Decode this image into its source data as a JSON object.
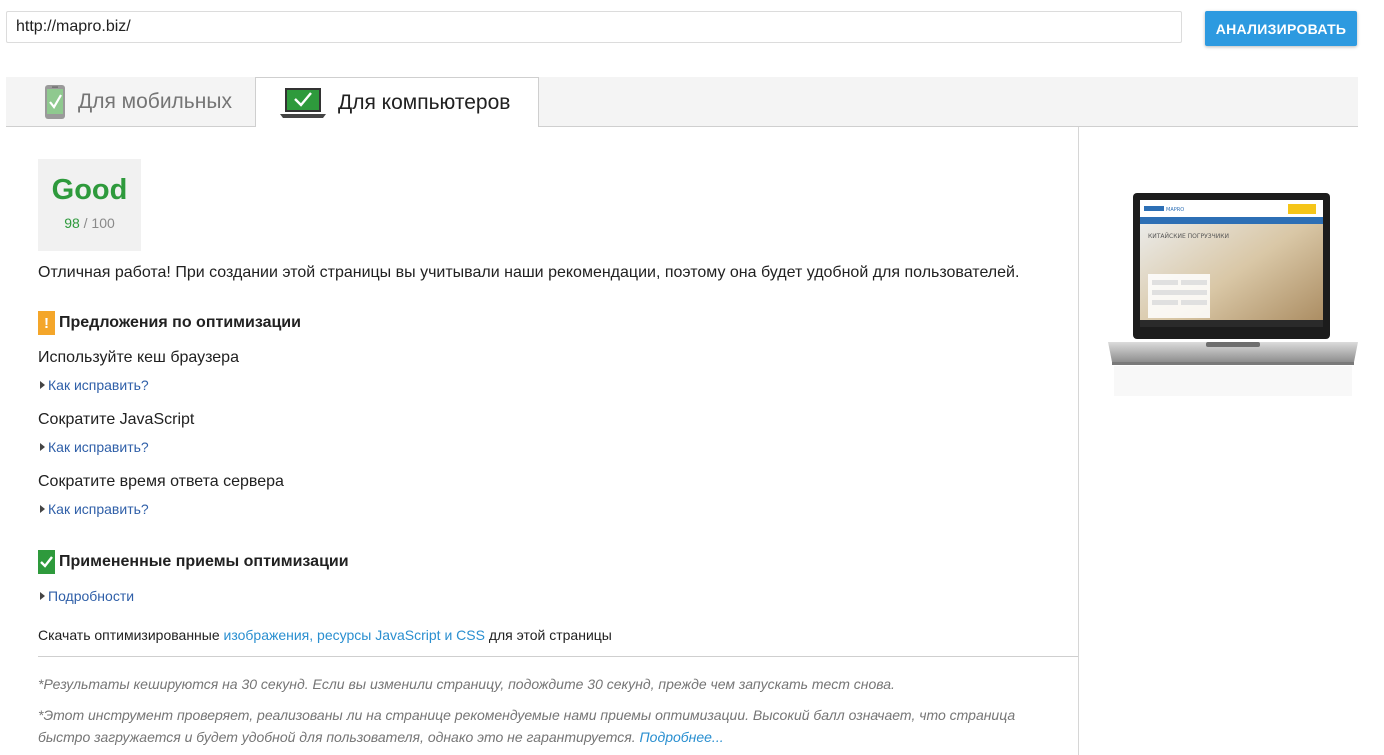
{
  "url_bar": {
    "value": "http://mapro.biz/",
    "analyze_label": "АНАЛИЗИРОВАТЬ",
    "accent": "#2d9ae0"
  },
  "tabs": [
    {
      "label": "Для мобильных",
      "icon": "smartphone-check-icon",
      "active": false
    },
    {
      "label": "Для компьютеров",
      "icon": "laptop-check-icon",
      "active": true
    }
  ],
  "score": {
    "label": "Good",
    "value": "98",
    "max": "/ 100",
    "color": "#2e9a3c"
  },
  "summary": "Отличная работа! При создании этой страницы вы учитывали наши рекомендации, поэтому она будет удобной для пользователей.",
  "suggestions": {
    "badge": "!",
    "badge_color": "#f4a62a",
    "title": "Предложения по оптимизации",
    "items": [
      {
        "title": "Используйте кеш браузера",
        "link": "Как исправить?"
      },
      {
        "title": "Сократите JavaScript",
        "link": "Как исправить?"
      },
      {
        "title": "Сократите время ответа сервера",
        "link": "Как исправить?"
      }
    ]
  },
  "applied": {
    "badge_icon": "check-icon",
    "badge_color": "#2e9a3c",
    "title": "Примененные приемы оптимизации",
    "link": "Подробности"
  },
  "download": {
    "prefix": "Скачать оптимизированные ",
    "link": "изображения, ресурсы JavaScript и CSS",
    "suffix": " для этой страницы"
  },
  "notes": {
    "cache": "*Результаты кешируются на 30 секунд. Если вы изменили страницу, подождите 30 секунд, прежде чем запускать тест снова.",
    "tool": "*Этот инструмент проверяет, реализованы ли на странице рекомендуемые нами приемы оптимизации. Высокий балл означает, что страница быстро загружается и будет удобной для пользователя, однако это не гарантируется.",
    "more_link": "Подробнее..."
  },
  "preview": {
    "icon": "laptop-preview-image",
    "heading": "КИТАЙСКИЕ ПОГРУЗЧИКИ",
    "logo": "MAPRO"
  }
}
